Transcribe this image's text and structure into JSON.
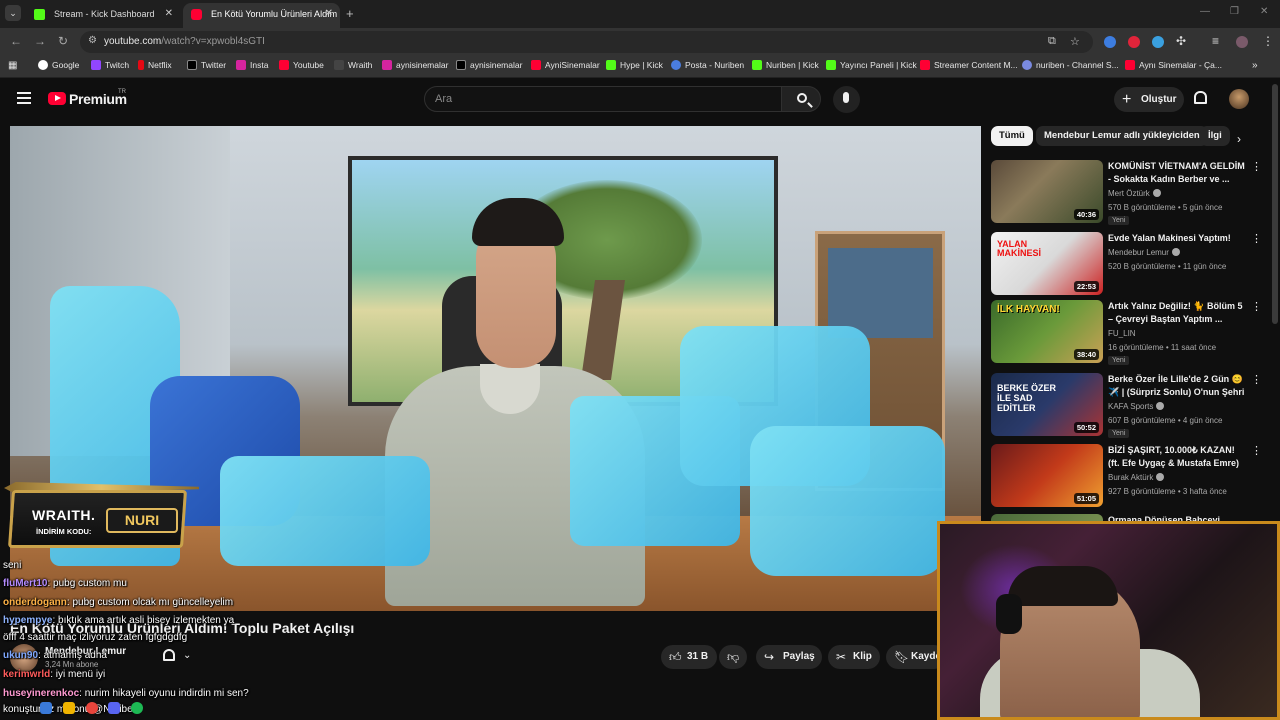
{
  "browser": {
    "tabs": [
      {
        "title": "Stream - Kick Dashboard"
      },
      {
        "title": "En Kötü Yorumlu Ürünleri Aldım"
      }
    ],
    "url_host": "youtube.com",
    "url_path": "/watch?v=xpwobl4sGTI",
    "bookmarks": [
      "Google",
      "Twitch",
      "Netflix",
      "Twitter",
      "Insta",
      "Youtube",
      "Wraith",
      "aynisinemalar",
      "aynisinemalar",
      "AyniSinemalar",
      "Hype | Kick",
      "Posta - Nuriben",
      "Nuriben | Kick",
      "Yayıncı Paneli | Kick",
      "Streamer Content M...",
      "nuriben - Channel S...",
      "Aynı Sinemalar - Ça..."
    ]
  },
  "youtube": {
    "brand": "Premium",
    "region": "TR",
    "search_placeholder": "Ara",
    "create_label": "Oluştur"
  },
  "ad": {
    "brand": "WRAITH.",
    "code_label": "İNDİRİM KODU:",
    "code": "NURI"
  },
  "video": {
    "title": "En Kötü Yorumlu Ürünleri Aldım! Toplu Paket Açılışı",
    "channel": "Mendebur Lemur",
    "subscribers": "3,24 Mn abone",
    "likes": "31 B",
    "share_label": "Paylaş",
    "clip_label": "Klip",
    "save_label": "Kayde"
  },
  "chat": [
    {
      "user": "",
      "message": "seni",
      "color": "#ffffff"
    },
    {
      "user": "fluMert10",
      "message": ": pubg custom mu",
      "color": "#b48cff"
    },
    {
      "user": "onderdogann",
      "message": ": pubg custom olcak mı güncelleyelim",
      "color": "#ffb347"
    },
    {
      "user": "hypempye",
      "message": ": bıktık ama artık asli bisey izlemekten ya",
      "color": "#8fb4ff"
    },
    {
      "user": "",
      "message": "öfff 4 saattir maç izliyoruz zaten fgfgdgdfg",
      "color": "#ffffff"
    },
    {
      "user": "ukun90",
      "message": ": atmamış adha",
      "color": "#7fa8ff"
    },
    {
      "user": "kerimwrld",
      "message": ": iyi menü iyi",
      "color": "#ff5c5c"
    },
    {
      "user": "huseyinerenkoc",
      "message": ": nurim hikayeli oyunu indirdin mi sen?",
      "color": "#ff9ad1"
    },
    {
      "user": "",
      "message": "konuştunuz mu onu @Nuriben",
      "color": "#ffffff"
    }
  ],
  "chips": [
    "Tümü",
    "Mendebur Lemur adlı yükleyiciden",
    "İlgi"
  ],
  "recommendations": [
    {
      "title": "KOMÜNİST VİETNAM'A GELDİM - Sokakta Kadın Berber ve ...",
      "channel": "Mert Öztürk",
      "meta": "570 B görüntüleme • 5 gün önce",
      "badge": "Yeni",
      "duration": "40:36"
    },
    {
      "title": "Evde Yalan Makinesi Yaptım!",
      "channel": "Mendebur Lemur",
      "meta": "520 B görüntüleme • 11 gün önce",
      "badge": "",
      "duration": "22:53"
    },
    {
      "title": "Artık Yalnız Değiliz! 🐈 Bölüm 5 – Çevreyi Baştan Yaptım ...",
      "channel": "FU_LIN",
      "meta": "16 görüntüleme • 11 saat önce",
      "badge": "Yeni",
      "duration": "38:40"
    },
    {
      "title": "Berke Özer İle Lille'de 2 Gün 😊 ✈️ | (Sürpriz Sonlu) O'nun Şehri",
      "channel": "KAFA Sports",
      "meta": "607 B görüntüleme • 4 gün önce",
      "badge": "Yeni",
      "duration": "50:52"
    },
    {
      "title": "BİZİ ŞAŞIRT, 10.000₺ KAZAN! (ft. Efe Uygaç & Mustafa Emre)",
      "channel": "Burak Aktürk",
      "meta": "927 B görüntüleme • 3 hafta önce",
      "badge": "",
      "duration": "51:05"
    },
    {
      "title": "Ormana Dönüşen Bahçeyi",
      "channel": "",
      "meta": "",
      "badge": "",
      "duration": ""
    }
  ],
  "thumb_text": {
    "t2": "YALAN MAKİNESİ",
    "t3": "İLK HAYVAN!",
    "t4": "BERKE ÖZER İLE SAD EDİTLER"
  }
}
